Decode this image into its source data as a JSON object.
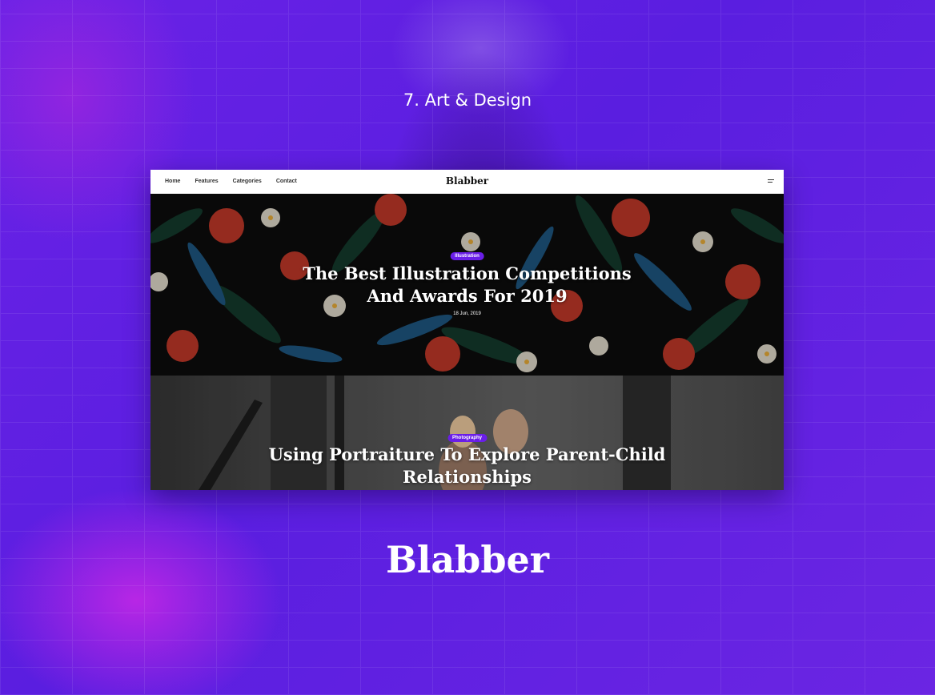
{
  "section": {
    "label": "7. Art & Design"
  },
  "site": {
    "logo": "Blabber",
    "nav": [
      "Home",
      "Features",
      "Categories",
      "Contact"
    ],
    "menu_icon": "hamburger-icon"
  },
  "posts": [
    {
      "category": "Illustration",
      "title_line1": "The Best Illustration Competitions",
      "title_line2": "And Awards For 2019",
      "date": "18 Jun, 2019"
    },
    {
      "category": "Photography",
      "title_line1": "Using Portraiture To Explore Parent-Child",
      "title_line2": "Relationships"
    }
  ],
  "brand": {
    "name": "Blabber"
  },
  "colors": {
    "accent": "#6a1ee8",
    "background": "#5a1fe0"
  }
}
